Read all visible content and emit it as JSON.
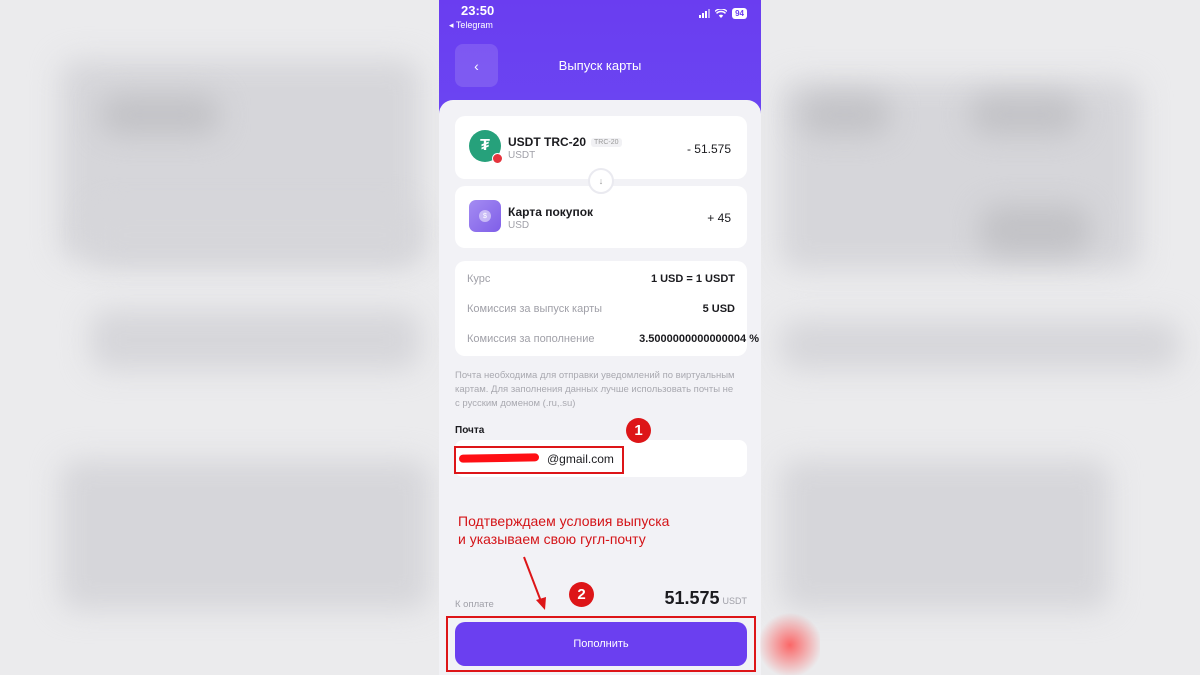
{
  "status_bar": {
    "time": "23:50",
    "back_app": "◂ Telegram",
    "battery": "94"
  },
  "header": {
    "back_icon": "chevron-left-icon",
    "title": "Выпуск карты"
  },
  "from_asset": {
    "icon": "tether-icon",
    "name": "USDT TRC-20",
    "tag": "TRC-20",
    "sub": "USDT",
    "amount": "- 51.575"
  },
  "swap_icon": "arrow-down-icon",
  "to_asset": {
    "icon": "card-icon",
    "name": "Карта покупок",
    "sub": "USD",
    "amount": "+ 45"
  },
  "details": [
    {
      "label": "Курс",
      "value": "1 USD = 1 USDT"
    },
    {
      "label": "Комиссия за выпуск карты",
      "value": "5 USD"
    },
    {
      "label": "Комиссия за пополнение",
      "value": "3.5000000000000004 %"
    }
  ],
  "note": "Почта необходима для отправки уведомлений по виртуальным картам. Для заполнения данных лучше использовать почты не с русским доменом (.ru,.su)",
  "email": {
    "label": "Почта",
    "value": "@gmail.com"
  },
  "payment": {
    "label": "К оплате",
    "amount": "51.575",
    "currency": "USDT"
  },
  "submit_label": "Пополнить",
  "annotations": {
    "step1": "1",
    "step2": "2",
    "text_line1": "Подтверждаем условия выпуска",
    "text_line2": "и указываем свою гугл-почту",
    "color": "#dd1518"
  },
  "colors": {
    "accent": "#6b3ff0",
    "tether": "#26a17b"
  }
}
